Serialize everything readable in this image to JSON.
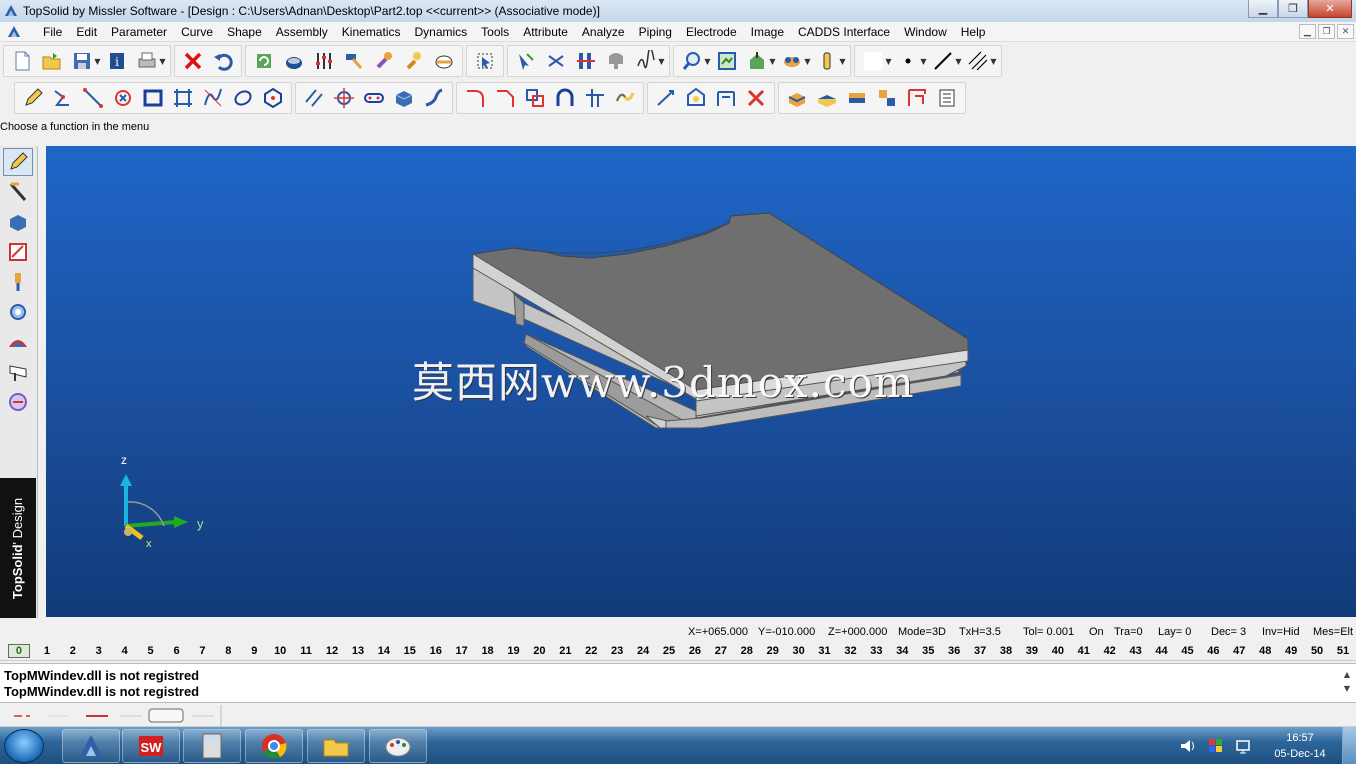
{
  "window": {
    "title": "TopSolid by Missler Software - [Design : C:\\Users\\Adnan\\Desktop\\Part2.top  <<current>> (Associative mode)]",
    "controls": [
      "minimize",
      "restore",
      "close"
    ]
  },
  "menu": [
    "File",
    "Edit",
    "Parameter",
    "Curve",
    "Shape",
    "Assembly",
    "Kinematics",
    "Dynamics",
    "Tools",
    "Attribute",
    "Analyze",
    "Piping",
    "Electrode",
    "Image",
    "CADDS Interface",
    "Window",
    "Help"
  ],
  "toolbar_top": {
    "groups": [
      [
        "new-icon",
        "open-icon",
        "save-icon",
        "info-icon",
        "print-icon"
      ],
      [
        "delete-icon",
        "undo-icon"
      ],
      [
        "refresh-icon",
        "mouse-icon",
        "sliders-icon",
        "hammer-icon",
        "wrench-icon",
        "tool-icon",
        "crop-icon"
      ],
      [
        "select-icon"
      ],
      [
        "pointer-icon",
        "cut-icon",
        "align-icon",
        "shape-icon",
        "sign-icon"
      ],
      [
        "zoom-icon",
        "zoom-all-icon",
        "view-icon",
        "render-icon",
        "color-icon"
      ],
      [
        "white-swatch-icon",
        "dot-icon",
        "line-style-icon",
        "hatch-icon"
      ]
    ]
  },
  "toolbar_bottom": {
    "groups": [
      [
        "pencil-icon",
        "polyline-icon",
        "line-icon",
        "point-icon",
        "rectangle-icon",
        "frame-icon",
        "spline-icon",
        "ellipse-icon",
        "hexagon-icon"
      ],
      [
        "parallel-icon",
        "crosshair-icon",
        "slot-icon",
        "solid-icon",
        "profile-icon"
      ],
      [
        "fillet-icon",
        "chamfer-icon",
        "offset-icon",
        "arch-icon",
        "trim-icon",
        "extend-icon"
      ],
      [
        "dimension-icon",
        "construct-icon",
        "measure-icon",
        "cancel-icon"
      ],
      [
        "block-icon",
        "plate-icon",
        "layered-icon",
        "stack-icon",
        "drawing-icon",
        "list-icon"
      ]
    ]
  },
  "prompt": "Choose a function in the menu",
  "left_toolbar": [
    "design-icon",
    "curve-icon",
    "shape-icon",
    "drafting-icon",
    "electrode-icon",
    "assembly-icon",
    "analysis-icon",
    "piping-icon",
    "render-icon"
  ],
  "brand": {
    "name": "TopSolid",
    "suffix": "' Design"
  },
  "viewport": {
    "watermark": "莫西网www.3dmox.com",
    "axes": {
      "z": "z",
      "y": "y",
      "x": "x"
    }
  },
  "status": {
    "x": "X=+065.000",
    "y": "Y=-010.000",
    "z": "Z=+000.000",
    "mode": "Mode=3D",
    "txh": "TxH=3.5",
    "tol": "Tol= 0.001",
    "on": "On",
    "tra": "Tra=0",
    "lay": "Lay=  0",
    "dec": "Dec= 3",
    "inv": "Inv=Hid",
    "mes": "Mes=Elt"
  },
  "layers": [
    "0",
    "1",
    "2",
    "3",
    "4",
    "5",
    "6",
    "7",
    "8",
    "9",
    "10",
    "11",
    "12",
    "13",
    "14",
    "15",
    "16",
    "17",
    "18",
    "19",
    "20",
    "21",
    "22",
    "23",
    "24",
    "25",
    "26",
    "27",
    "28",
    "29",
    "30",
    "31",
    "32",
    "33",
    "34",
    "35",
    "36",
    "37",
    "38",
    "39",
    "40",
    "41",
    "42",
    "43",
    "44",
    "45",
    "46",
    "47",
    "48",
    "49",
    "50",
    "51"
  ],
  "active_layer": "0",
  "messages": [
    "TopMWindev.dll is not registred",
    "TopMWindev.dll is not registred"
  ],
  "taskbar": {
    "apps": [
      "topsolid-icon",
      "solidworks-icon",
      "calculator-icon",
      "chrome-icon",
      "explorer-icon",
      "paint-icon"
    ],
    "time": "16:57",
    "date": "05-Dec-14"
  },
  "colors": {
    "viewport_top": "#1f66c8",
    "viewport_bottom": "#123a78",
    "part_top": "#6f6f6f",
    "part_side": "#c9c9c9"
  }
}
